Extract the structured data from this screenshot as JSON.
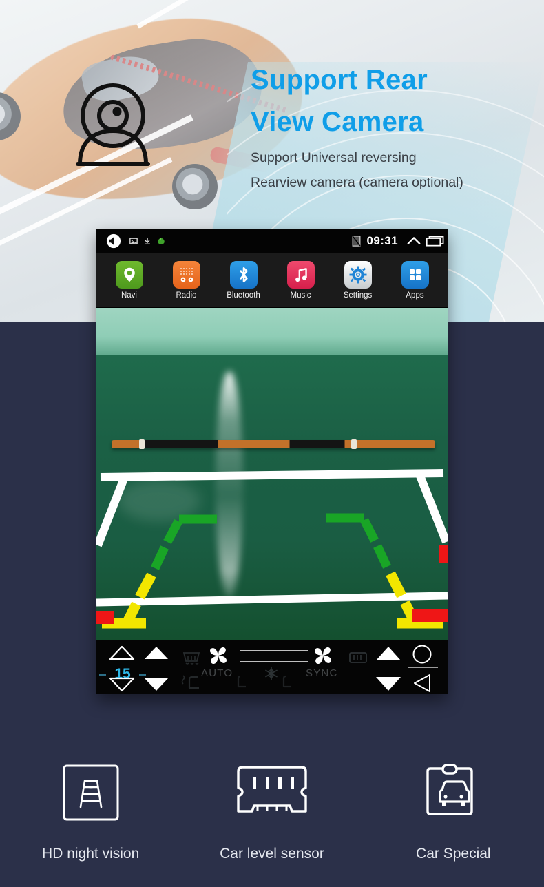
{
  "hero": {
    "headline_line1": "Support Rear",
    "headline_line2": "View Camera",
    "sub_line1": "Support Universal reversing",
    "sub_line2": "Rearview camera (camera optional)",
    "headline_color": "#109ee8",
    "camera_icon": "webcam-icon"
  },
  "device": {
    "status_bar": {
      "time": "09:31",
      "volume_icon": "speaker-icon",
      "screenshot_icon": "image-icon",
      "download_icon": "download-icon",
      "app_icon": "green-app-icon",
      "signal_icon": "no-sim-icon",
      "expand_icon": "chevron-up-icon",
      "recents_icon": "recents-icon"
    },
    "dock": [
      {
        "label": "Navi",
        "icon": "map-pin-icon",
        "color": "#5aa824"
      },
      {
        "label": "Radio",
        "icon": "radio-icon",
        "color": "#e9701f"
      },
      {
        "label": "Bluetooth",
        "icon": "bluetooth-icon",
        "color": "#1f84d6"
      },
      {
        "label": "Music",
        "icon": "music-note-icon",
        "color": "#e12f58"
      },
      {
        "label": "Settings",
        "icon": "gear-icon",
        "color": "#dfe3e5"
      },
      {
        "label": "Apps",
        "icon": "grid-icon",
        "color": "#1f84d6"
      }
    ],
    "camera_view": {
      "description": "rear view camera feed",
      "guide_colors": {
        "green": "#19a526",
        "yellow": "#f2e600",
        "red": "#ef1616",
        "line": "#ffffff"
      }
    },
    "climate": {
      "temperature": "15",
      "temperature_color": "#2eb8e8",
      "auto_label": "AUTO",
      "sync_label": "SYNC",
      "controls": [
        "temp-up-outline-icon",
        "temp-down-outline-icon",
        "fan-up-icon",
        "fan-down-icon",
        "front-defrost-icon",
        "fan-icon",
        "snowflake-icon",
        "fan-sync-icon",
        "rear-defrost-icon",
        "seat-heat-left-icon",
        "seat-heat-right-icon",
        "volume-up-icon",
        "volume-down-icon",
        "home-circle-icon",
        "back-triangle-icon"
      ]
    }
  },
  "features": [
    {
      "label": "HD night vision",
      "icon": "parking-guideline-icon"
    },
    {
      "label": "Car level sensor",
      "icon": "bumper-sensor-icon"
    },
    {
      "label": "Car Special",
      "icon": "car-front-icon"
    }
  ],
  "theme": {
    "background": "#2b3049",
    "hero_background": "#e7ebee",
    "accent": "#109ee8"
  }
}
